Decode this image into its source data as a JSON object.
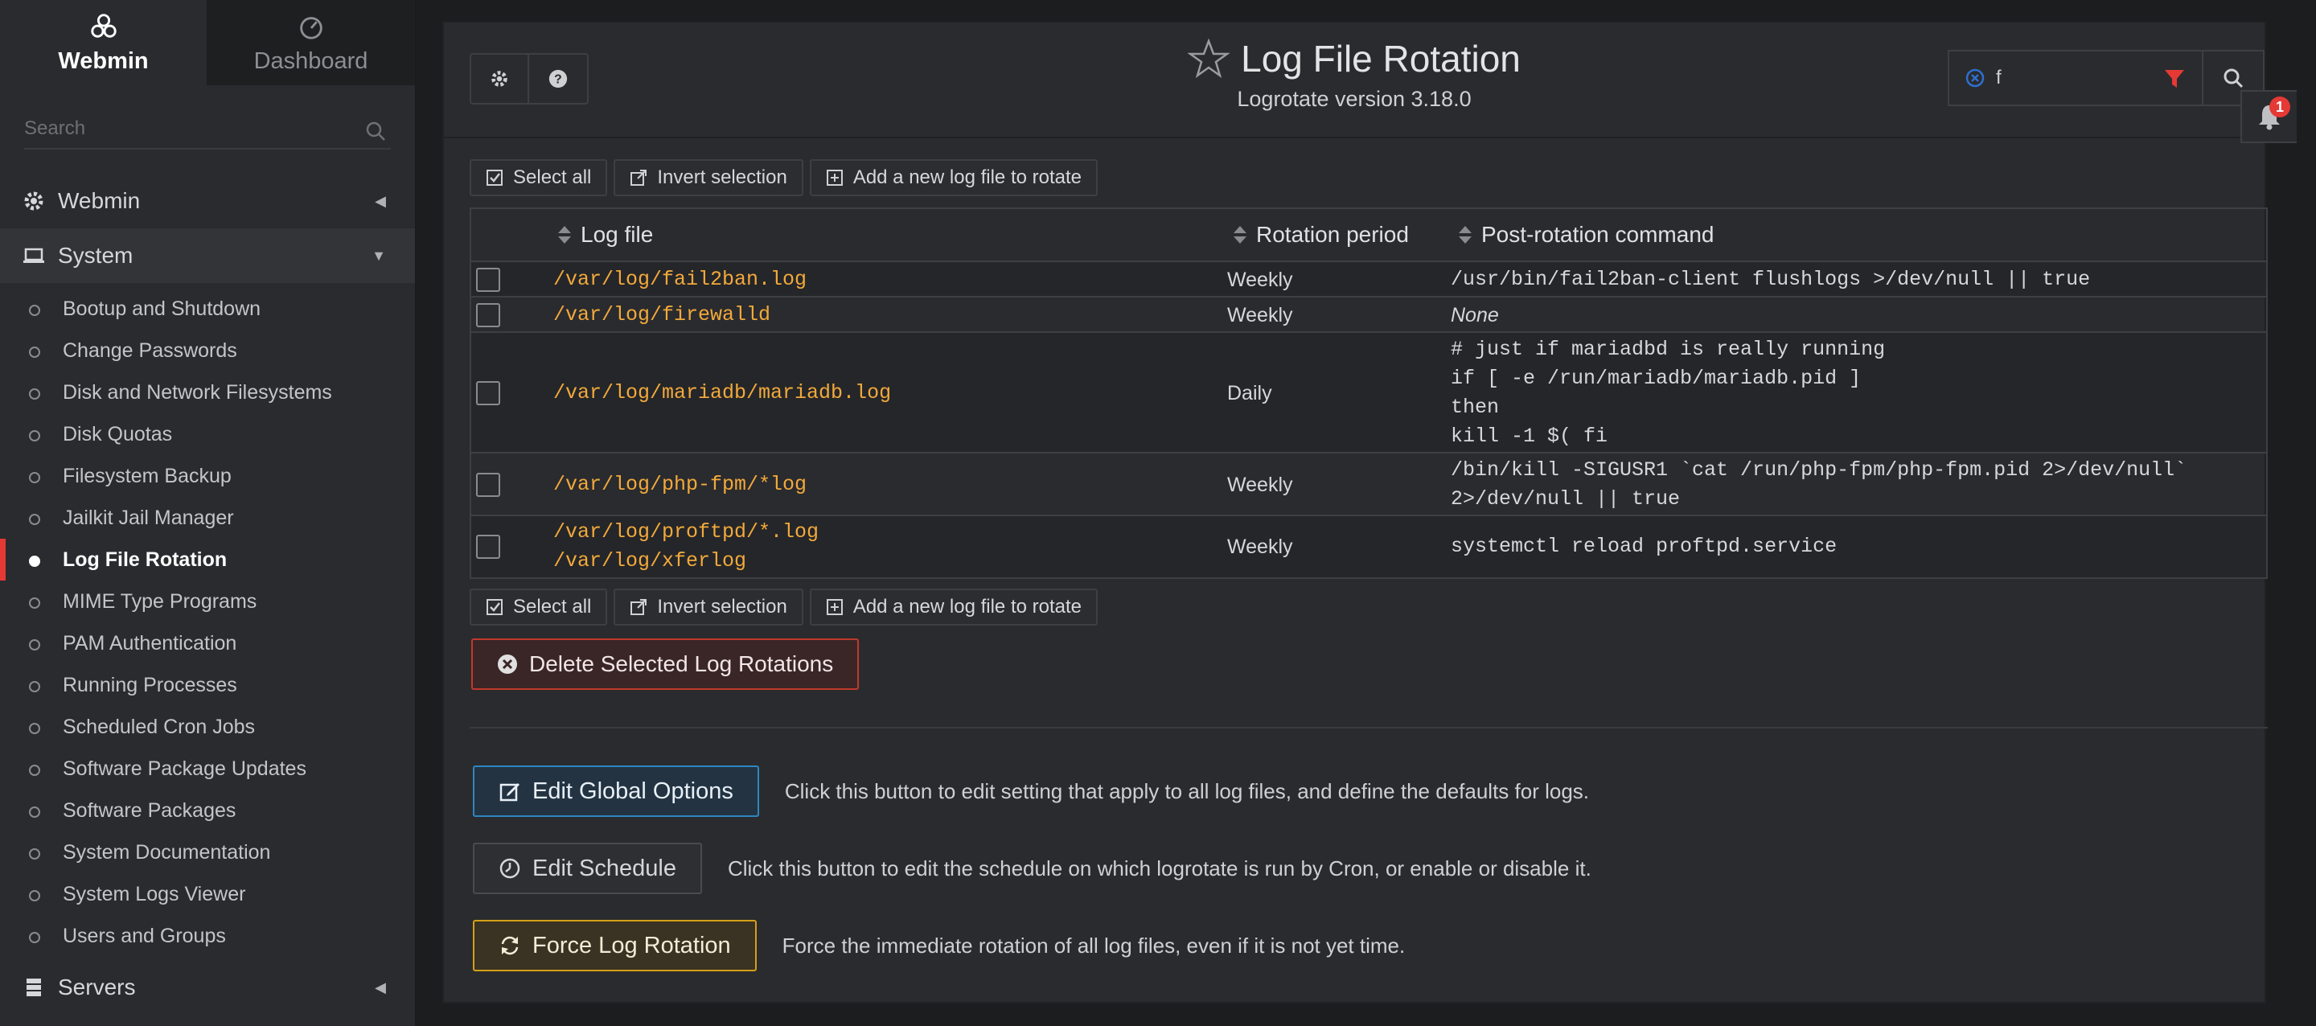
{
  "sidebar": {
    "tabs": [
      {
        "label": "Webmin",
        "icon": "webmin-logo-icon"
      },
      {
        "label": "Dashboard",
        "icon": "dashboard-gauge-icon"
      }
    ],
    "search_placeholder": "Search",
    "categories": {
      "webmin": "Webmin",
      "system": "System",
      "servers": "Servers"
    },
    "system_items": [
      "Bootup and Shutdown",
      "Change Passwords",
      "Disk and Network Filesystems",
      "Disk Quotas",
      "Filesystem Backup",
      "Jailkit Jail Manager",
      "Log File Rotation",
      "MIME Type Programs",
      "PAM Authentication",
      "Running Processes",
      "Scheduled Cron Jobs",
      "Software Package Updates",
      "Software Packages",
      "System Documentation",
      "System Logs Viewer",
      "Users and Groups"
    ],
    "active_item": "Log File Rotation"
  },
  "header": {
    "title": "Log File Rotation",
    "subtitle": "Logrotate version 3.18.0",
    "filter_value": "f",
    "notification_count": "1"
  },
  "toolbar": {
    "select_all": "Select all",
    "invert_selection": "Invert selection",
    "add_new": "Add a new log file to rotate"
  },
  "table": {
    "columns": [
      "Log file",
      "Rotation period",
      "Post-rotation command"
    ],
    "rows": [
      {
        "files": [
          "/var/log/fail2ban.log"
        ],
        "period": "Weekly",
        "command": "/usr/bin/fail2ban-client flushlogs >/dev/null || true"
      },
      {
        "files": [
          "/var/log/firewalld"
        ],
        "period": "Weekly",
        "command": "None"
      },
      {
        "files": [
          "/var/log/mariadb/mariadb.log"
        ],
        "period": "Daily",
        "command": "# just if mariadbd is really running\nif [ -e /run/mariadb/mariadb.pid ]\nthen\nkill -1 $( fi"
      },
      {
        "files": [
          "/var/log/php-fpm/*log"
        ],
        "period": "Weekly",
        "command": "/bin/kill -SIGUSR1 `cat /run/php-fpm/php-fpm.pid 2>/dev/null`\n2>/dev/null || true"
      },
      {
        "files": [
          "/var/log/proftpd/*.log",
          "/var/log/xferlog"
        ],
        "period": "Weekly",
        "command": "systemctl reload proftpd.service"
      }
    ]
  },
  "delete_button": "Delete Selected Log Rotations",
  "actions": [
    {
      "label": "Edit Global Options",
      "description": "Click this button to edit setting that apply to all log files, and define the defaults for logs."
    },
    {
      "label": "Edit Schedule",
      "description": "Click this button to edit the schedule on which logrotate is run by Cron, or enable or disable it."
    },
    {
      "label": "Force Log Rotation",
      "description": "Force the immediate rotation of all log files, even if it is not yet time."
    }
  ],
  "colors": {
    "accent_red": "#e53935",
    "log_path": "#f2a93b",
    "global_btn": "#2e86c1",
    "force_btn": "#d4a017"
  }
}
